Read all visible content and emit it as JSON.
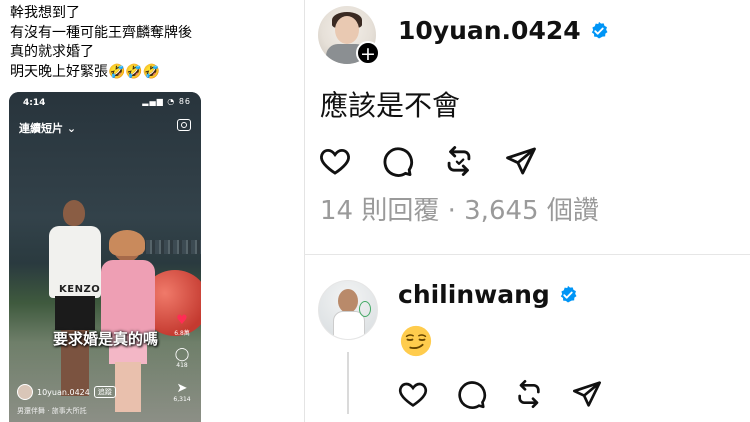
{
  "left_post": {
    "lines": [
      "幹我想到了",
      "有沒有一種可能王齊麟奪牌後",
      "真的就求婚了",
      "明天晚上好緊張🤣🤣🤣"
    ]
  },
  "phone": {
    "status_time": "4:14",
    "status_icons": "▂▄▆ ◔ 86",
    "header_title": "連續短片",
    "caption": "要求婚是真的嗎",
    "side_buttons": [
      {
        "icon": "heart-icon",
        "count": "6.8萬"
      },
      {
        "icon": "comment-icon",
        "count": "418"
      },
      {
        "icon": "share-icon",
        "count": "6,314"
      }
    ],
    "username": "10yuan.0424",
    "follow_label": "追蹤",
    "music": "男還伴舞 · 旅事大所託"
  },
  "post": {
    "username": "10yuan.0424",
    "text": "應該是不會",
    "stats": "14 則回覆 · 3,645 個讚"
  },
  "reply": {
    "username": "chilinwang",
    "emoji": "smirking-face"
  },
  "colors": {
    "verified_blue": "#0095f6",
    "stats_gray": "#9a9a9a",
    "heart_red": "#ff2d55"
  }
}
